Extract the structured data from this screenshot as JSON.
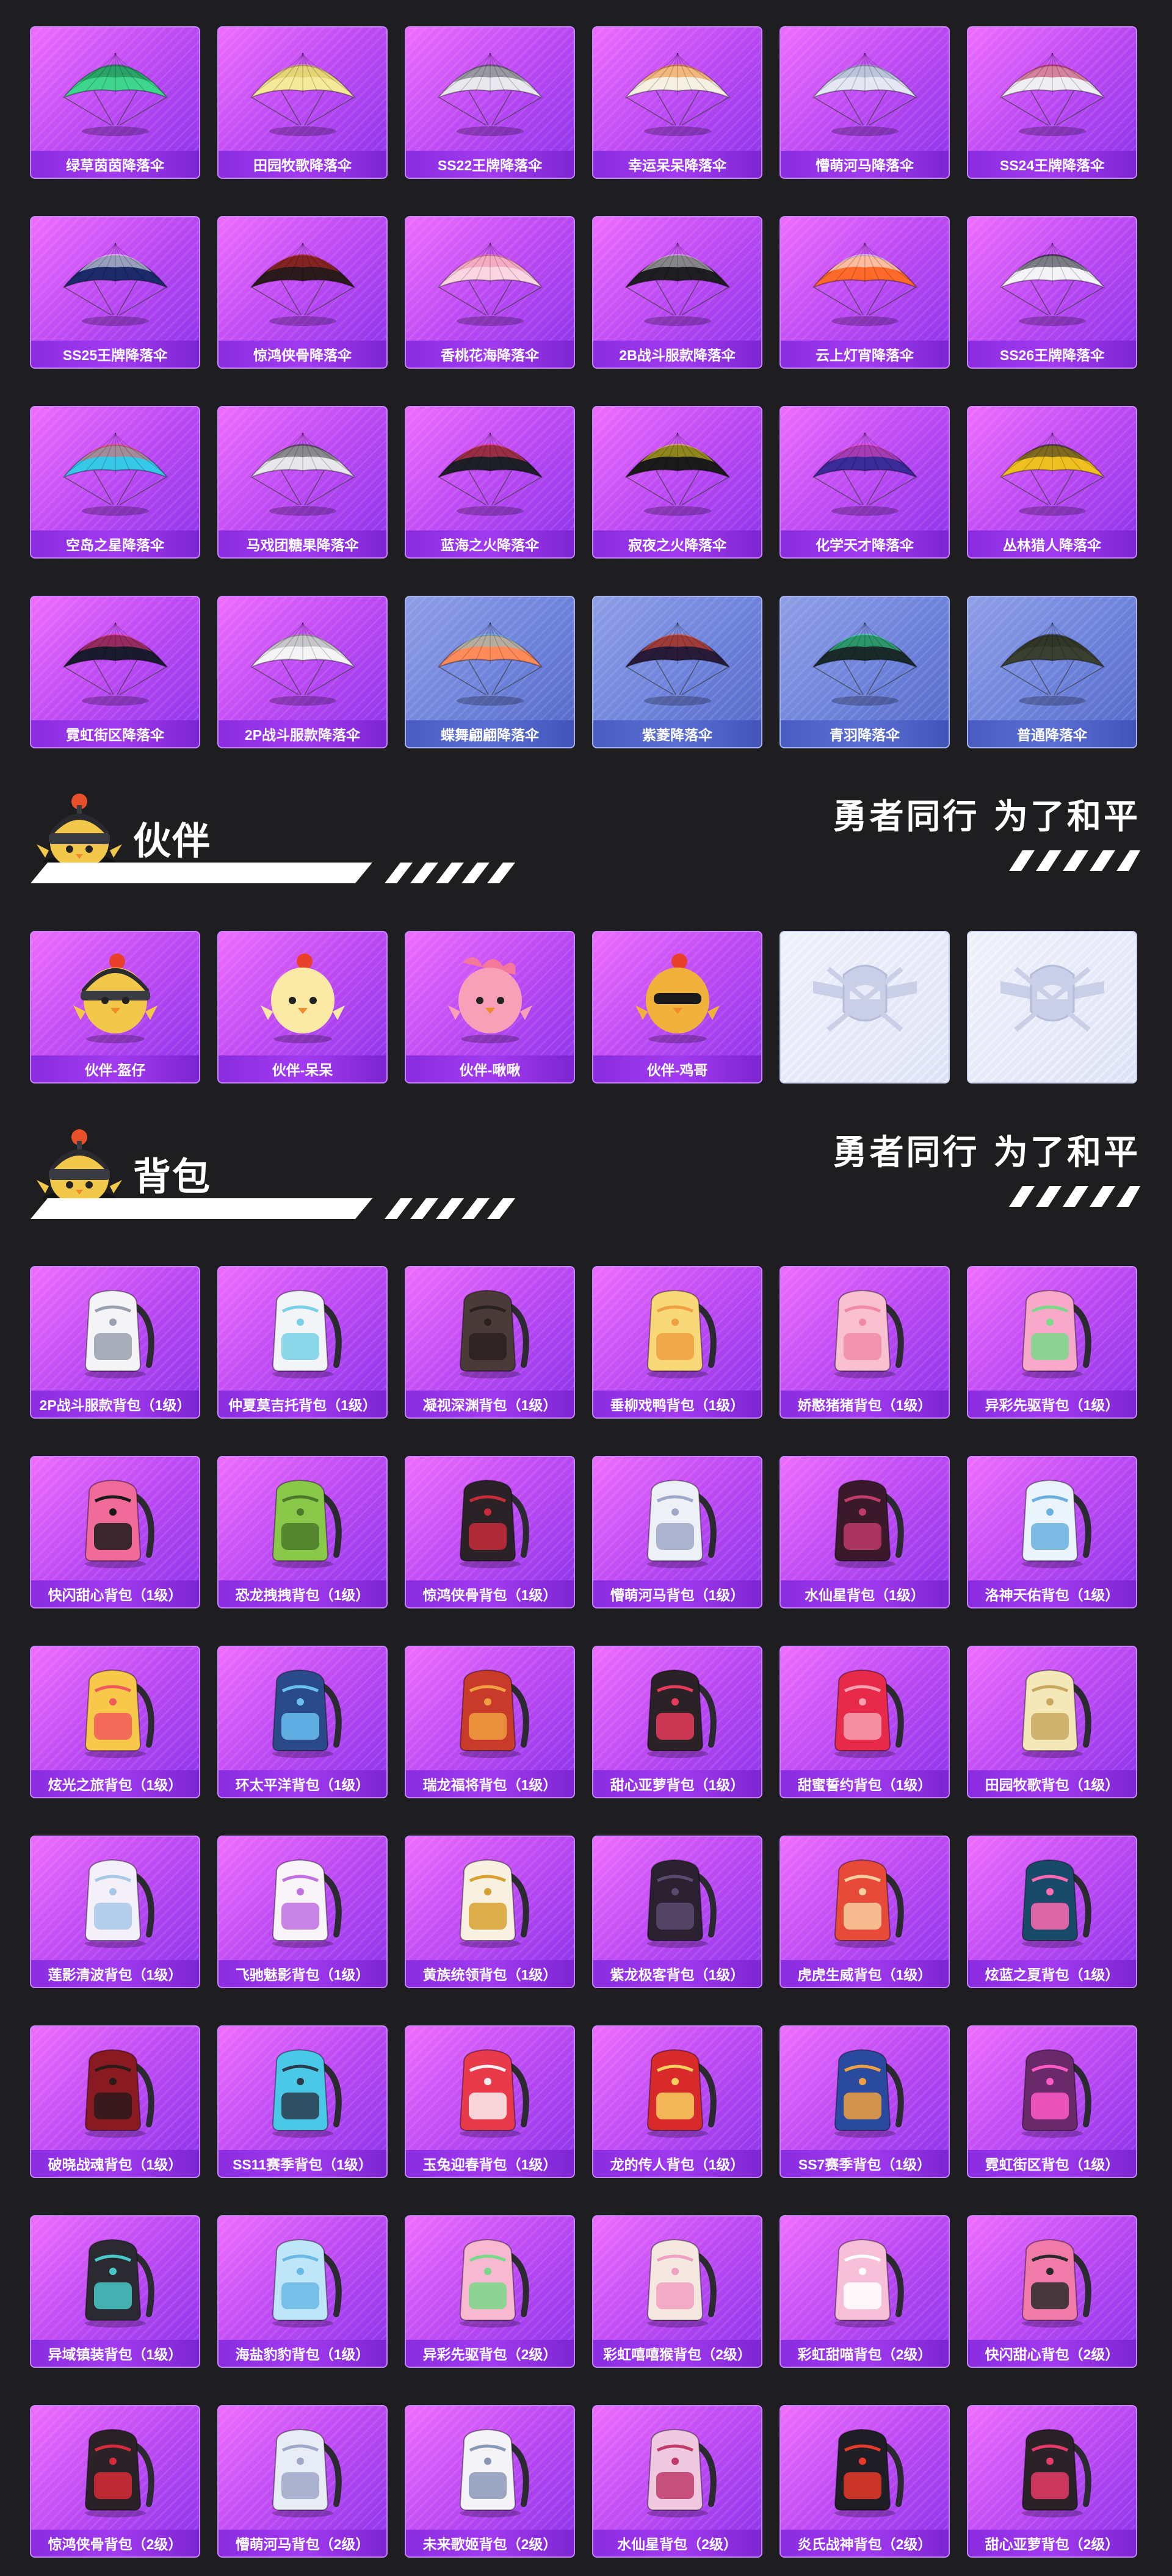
{
  "parachutes": [
    {
      "label": "绿草茵茵降落伞",
      "icon": "parachute-icon",
      "color": "#3dd68c",
      "accent": "#1a7a4a",
      "theme": "purple"
    },
    {
      "label": "田园牧歌降落伞",
      "icon": "parachute-icon",
      "color": "#f6ea9a",
      "accent": "#d8c25a",
      "theme": "purple"
    },
    {
      "label": "SS22王牌降落伞",
      "icon": "parachute-icon",
      "color": "#e8e8ee",
      "accent": "#555560",
      "theme": "purple"
    },
    {
      "label": "幸运呆呆降落伞",
      "icon": "parachute-icon",
      "color": "#f6f0e2",
      "accent": "#f08a2a",
      "theme": "purple"
    },
    {
      "label": "懵萌河马降落伞",
      "icon": "parachute-icon",
      "color": "#e4e8f4",
      "accent": "#9aa6c8",
      "theme": "purple"
    },
    {
      "label": "SS24王牌降落伞",
      "icon": "parachute-icon",
      "color": "#f0eef2",
      "accent": "#c02a5a",
      "theme": "purple"
    },
    {
      "label": "SS25王牌降落伞",
      "icon": "parachute-icon",
      "color": "#1a2a6a",
      "accent": "#ffffff",
      "theme": "purple"
    },
    {
      "label": "惊鸿侠骨降落伞",
      "icon": "parachute-icon",
      "color": "#2a1a1a",
      "accent": "#d02a2a",
      "theme": "purple"
    },
    {
      "label": "香桃花海降落伞",
      "icon": "parachute-icon",
      "color": "#fbd6e2",
      "accent": "#f08aa8",
      "theme": "purple"
    },
    {
      "label": "2B战斗服款降落伞",
      "icon": "parachute-icon",
      "color": "#1e1e22",
      "accent": "#dcdcdc",
      "theme": "purple"
    },
    {
      "label": "云上灯宵降落伞",
      "icon": "parachute-icon",
      "color": "#ff6a2a",
      "accent": "#ffffff",
      "theme": "purple"
    },
    {
      "label": "SS26王牌降落伞",
      "icon": "parachute-icon",
      "color": "#f4f4f8",
      "accent": "#1a1a2a",
      "theme": "purple"
    },
    {
      "label": "空岛之星降落伞",
      "icon": "parachute-icon",
      "color": "#36c8e8",
      "accent": "#ff5a5a",
      "theme": "purple"
    },
    {
      "label": "马戏团糖果降落伞",
      "icon": "parachute-icon",
      "color": "#e8e8ec",
      "accent": "#3a3a40",
      "theme": "purple"
    },
    {
      "label": "蓝海之火降落伞",
      "icon": "parachute-icon",
      "color": "#1e1e28",
      "accent": "#ff3a5a",
      "theme": "purple"
    },
    {
      "label": "寂夜之火降落伞",
      "icon": "parachute-icon",
      "color": "#1a1a1a",
      "accent": "#f0e020",
      "theme": "purple"
    },
    {
      "label": "化学天才降落伞",
      "icon": "parachute-icon",
      "color": "#3a2a9a",
      "accent": "#ff4ac8",
      "theme": "purple"
    },
    {
      "label": "丛林猎人降落伞",
      "icon": "parachute-icon",
      "color": "#f0c020",
      "accent": "#202020",
      "theme": "purple"
    },
    {
      "label": "霓虹街区降落伞",
      "icon": "parachute-icon",
      "color": "#1a1a2e",
      "accent": "#ff3a8a",
      "theme": "purple"
    },
    {
      "label": "2P战斗服款降落伞",
      "icon": "parachute-icon",
      "color": "#f4f4f6",
      "accent": "#a0a0a8",
      "theme": "purple"
    },
    {
      "label": "蝶舞翩翩降落伞",
      "icon": "parachute-icon",
      "color": "#ff8a5a",
      "accent": "#7ac8d8",
      "theme": "blue"
    },
    {
      "label": "紫菱降落伞",
      "icon": "parachute-icon",
      "color": "#2a1a3a",
      "accent": "#ff5a3a",
      "theme": "blue"
    },
    {
      "label": "青羽降落伞",
      "icon": "parachute-icon",
      "color": "#1a2a2a",
      "accent": "#3af0a0",
      "theme": "blue"
    },
    {
      "label": "普通降落伞",
      "icon": "parachute-icon",
      "color": "#3a4030",
      "accent": "#2a2e22",
      "theme": "blue"
    }
  ],
  "companion_section": {
    "title": "伙伴",
    "slogan": "勇者同行 为了和平",
    "mascot_icon": "chick-mascot-icon"
  },
  "companions": [
    {
      "label": "伙伴-盔仔",
      "icon": "chick-helmet-icon",
      "color": "#f2c84a",
      "theme": "purple"
    },
    {
      "label": "伙伴-呆呆",
      "icon": "chick-icon",
      "color": "#fbeaa6",
      "theme": "purple"
    },
    {
      "label": "伙伴-啾啾",
      "icon": "pink-bird-icon",
      "color": "#f7a0b8",
      "theme": "purple"
    },
    {
      "label": "伙伴-鸡哥",
      "icon": "rooster-sunglasses-icon",
      "color": "#f0b23a",
      "theme": "purple"
    },
    {
      "label": "",
      "icon": "peace-elite-emblem-icon",
      "color": "#c9cfe6",
      "theme": "empty"
    },
    {
      "label": "",
      "icon": "peace-elite-emblem-icon",
      "color": "#c9cfe6",
      "theme": "empty"
    }
  ],
  "backpack_section": {
    "title": "背包",
    "slogan": "勇者同行 为了和平",
    "mascot_icon": "chick-mascot-icon"
  },
  "backpacks": [
    {
      "label": "2P战斗服款背包（1级）",
      "icon": "backpack-icon",
      "color": "#f4f4f6",
      "accent": "#9aa0b0"
    },
    {
      "label": "仲夏莫吉托背包（1级）",
      "icon": "backpack-icon",
      "color": "#f2f4f8",
      "accent": "#7ad0e8"
    },
    {
      "label": "凝视深渊背包（1级）",
      "icon": "backpack-icon",
      "color": "#4a3a38",
      "accent": "#2a2020"
    },
    {
      "label": "垂柳戏鸭背包（1级）",
      "icon": "backpack-icon",
      "color": "#f8d878",
      "accent": "#f0a040"
    },
    {
      "label": "娇憨猪猪背包（1级）",
      "icon": "backpack-icon",
      "color": "#f8c0d0",
      "accent": "#f08aa8"
    },
    {
      "label": "异彩先驱背包（1级）",
      "icon": "backpack-icon",
      "color": "#f8a8c8",
      "accent": "#7ad88a"
    },
    {
      "label": "快闪甜心背包（1级）",
      "icon": "backpack-icon",
      "color": "#f06a9a",
      "accent": "#1a1a1a"
    },
    {
      "label": "恐龙拽拽背包（1级）",
      "icon": "backpack-icon",
      "color": "#8ac84a",
      "accent": "#4a7a2a"
    },
    {
      "label": "惊鸿侠骨背包（1级）",
      "icon": "backpack-icon",
      "color": "#2a2226",
      "accent": "#c82a3a"
    },
    {
      "label": "懵萌河马背包（1级）",
      "icon": "backpack-icon",
      "color": "#eef0f8",
      "accent": "#a0a8c8"
    },
    {
      "label": "水仙星背包（1级）",
      "icon": "backpack-icon",
      "color": "#3a1a2a",
      "accent": "#c03a6a"
    },
    {
      "label": "洛神天佑背包（1级）",
      "icon": "backpack-icon",
      "color": "#eaf4fa",
      "accent": "#6ab0e0"
    },
    {
      "label": "炫光之旅背包（1级）",
      "icon": "backpack-icon",
      "color": "#f8c84a",
      "accent": "#f05a5a"
    },
    {
      "label": "环太平洋背包（1级）",
      "icon": "backpack-icon",
      "color": "#2a4a8a",
      "accent": "#6ac0f0"
    },
    {
      "label": "瑞龙福将背包（1级）",
      "icon": "backpack-icon",
      "color": "#c83a2a",
      "accent": "#f0a040"
    },
    {
      "label": "甜心亚萝背包（1级）",
      "icon": "backpack-icon",
      "color": "#2a2226",
      "accent": "#e83a5a"
    },
    {
      "label": "甜蜜誓约背包（1级）",
      "icon": "backpack-icon",
      "color": "#e82a4a",
      "accent": "#f8a0b0"
    },
    {
      "label": "田园牧歌背包（1级）",
      "icon": "backpack-icon",
      "color": "#f4e8b8",
      "accent": "#c8a860"
    },
    {
      "label": "莲影清波背包（1级）",
      "icon": "backpack-icon",
      "color": "#f4f0fa",
      "accent": "#a8c8e8"
    },
    {
      "label": "飞驰魅影背包（1级）",
      "icon": "backpack-icon",
      "color": "#f8f4f8",
      "accent": "#c070e0"
    },
    {
      "label": "黄族统领背包（1级）",
      "icon": "backpack-icon",
      "color": "#f8f0e0",
      "accent": "#d8a030"
    },
    {
      "label": "紫龙极客背包（1级）",
      "icon": "backpack-icon",
      "color": "#2a2230",
      "accent": "#5a4a70"
    },
    {
      "label": "虎虎生威背包（1级）",
      "icon": "backpack-icon",
      "color": "#e84a3a",
      "accent": "#f8d0a0"
    },
    {
      "label": "炫蓝之夏背包（1级）",
      "icon": "backpack-icon",
      "color": "#1a4a6a",
      "accent": "#ff6ab0"
    },
    {
      "label": "破晓战魂背包（1级）",
      "icon": "backpack-icon",
      "color": "#8a1a22",
      "accent": "#2a1a1a"
    },
    {
      "label": "SS11赛季背包（1级）",
      "icon": "backpack-icon",
      "color": "#4ac8e8",
      "accent": "#2a3a4a"
    },
    {
      "label": "玉兔迎春背包（1级）",
      "icon": "backpack-icon",
      "color": "#e83a4a",
      "accent": "#f8f0f0"
    },
    {
      "label": "龙的传人背包（1级）",
      "icon": "backpack-icon",
      "color": "#d82a2a",
      "accent": "#f8d060"
    },
    {
      "label": "SS7赛季背包（1级）",
      "icon": "backpack-icon",
      "color": "#2a4aa0",
      "accent": "#f0a040"
    },
    {
      "label": "霓虹街区背包（1级）",
      "icon": "backpack-icon",
      "color": "#6a2a6a",
      "accent": "#ff5ac8"
    },
    {
      "label": "异域镇装背包（1级）",
      "icon": "backpack-icon",
      "color": "#2a2a30",
      "accent": "#4ac8c8"
    },
    {
      "label": "海盐豹豹背包（1级）",
      "icon": "backpack-icon",
      "color": "#bfe6f8",
      "accent": "#6ab8e8"
    },
    {
      "label": "异彩先驱背包（2级）",
      "icon": "backpack-icon",
      "color": "#f8b8d0",
      "accent": "#7ad88a"
    },
    {
      "label": "彩虹嘻嘻猴背包（2级）",
      "icon": "backpack-icon",
      "color": "#f4e8e0",
      "accent": "#f0a0c0"
    },
    {
      "label": "彩虹甜喵背包（2级）",
      "icon": "backpack-icon",
      "color": "#f8c0d8",
      "accent": "#ffffff"
    },
    {
      "label": "快闪甜心背包（2级）",
      "icon": "backpack-icon",
      "color": "#f07aa8",
      "accent": "#2a2a2a"
    },
    {
      "label": "惊鸿侠骨背包（2级）",
      "icon": "backpack-icon",
      "color": "#2a2226",
      "accent": "#d82a3a"
    },
    {
      "label": "懵萌河马背包（2级）",
      "icon": "backpack-icon",
      "color": "#e8ecf4",
      "accent": "#a0a8c8"
    },
    {
      "label": "未来歌姬背包（2级）",
      "icon": "backpack-icon",
      "color": "#f4f4f8",
      "accent": "#8a98b8"
    },
    {
      "label": "水仙星背包（2级）",
      "icon": "backpack-icon",
      "color": "#f0c8e0",
      "accent": "#c03a6a"
    },
    {
      "label": "炎氏战神背包（2级）",
      "icon": "backpack-icon",
      "color": "#1e1e24",
      "accent": "#e83a2a"
    },
    {
      "label": "甜心亚萝背包（2级）",
      "icon": "backpack-icon",
      "color": "#2a2226",
      "accent": "#e83a6a"
    }
  ]
}
